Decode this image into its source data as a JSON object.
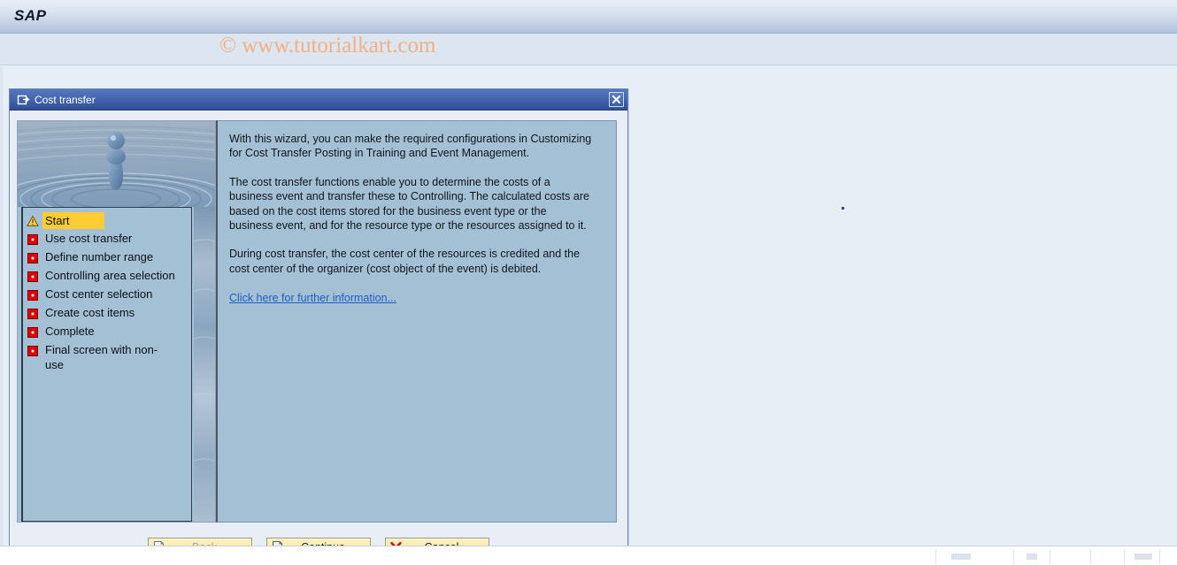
{
  "header": {
    "logo": "SAP",
    "watermark": "© www.tutorialkart.com"
  },
  "dialog": {
    "title": "Cost transfer",
    "title_icon": "window-restore-icon",
    "close_icon": "close-icon",
    "close_label": "Close"
  },
  "sidebar": {
    "graphic_name": "water-droplet-splash-graphic",
    "steps": [
      {
        "label": "Start",
        "icon": "warning-triangle-icon",
        "state": "active"
      },
      {
        "label": "Use cost transfer",
        "icon": "red-square-icon",
        "state": "pending"
      },
      {
        "label": "Define number range",
        "icon": "red-square-icon",
        "state": "pending"
      },
      {
        "label": "Controlling area selection",
        "icon": "red-square-icon",
        "state": "pending"
      },
      {
        "label": "Cost center selection",
        "icon": "red-square-icon",
        "state": "pending"
      },
      {
        "label": "Create cost items",
        "icon": "red-square-icon",
        "state": "pending"
      },
      {
        "label": "Complete",
        "icon": "red-square-icon",
        "state": "pending"
      },
      {
        "label": "Final screen with non-use",
        "icon": "red-square-icon",
        "state": "pending"
      }
    ]
  },
  "content": {
    "paragraph_1": "With this wizard, you can make the required configurations in Customizing for Cost Transfer Posting in Training and Event Management.",
    "paragraph_2": "The cost transfer functions enable you to determine the costs of a business event and transfer these to Controlling. The calculated costs are based on the cost items stored for the business event type or the business event, and for the resource type or the resources assigned to it.",
    "paragraph_3": "During cost transfer, the cost center of the resources is credited and the cost center of the organizer (cost object of the event) is debited.",
    "link_text": "Click here for further information..."
  },
  "footer": {
    "back": {
      "label": "Back",
      "icon": "page-back-arrow-icon",
      "enabled": false
    },
    "continue": {
      "label": "Continue",
      "icon": "page-forward-arrow-icon",
      "enabled": true
    },
    "cancel": {
      "label": "Cancel",
      "icon": "red-x-icon",
      "enabled": true
    }
  },
  "colors": {
    "titlebar_blue": "#2f4f95",
    "panel_blue": "#a3c0d4",
    "canvas": "#e8eef5",
    "highlight_yellow": "#ffcc33",
    "button_yellow": "#fbe9a3",
    "link_blue": "#1d5fc4",
    "watermark_orange": "#f0b183",
    "step_marker_red": "#e00000"
  }
}
